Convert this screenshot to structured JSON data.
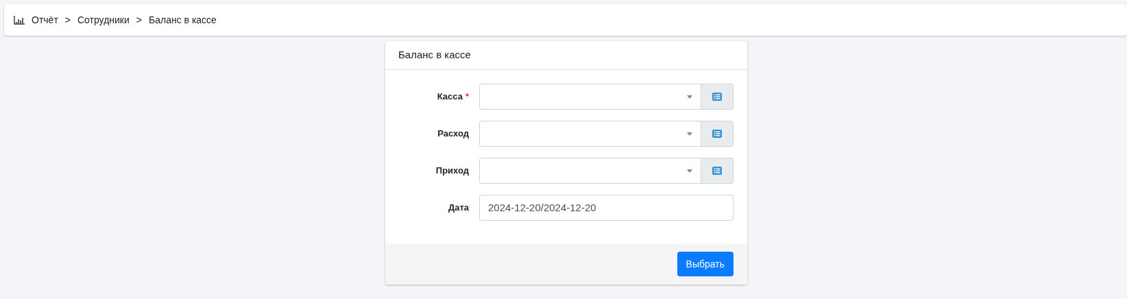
{
  "breadcrumb": [
    "Отчёт",
    "Сотрудники",
    "Баланс в кассе"
  ],
  "breadcrumb_separator": ">",
  "card": {
    "title": "Баланс в кассе",
    "fields": [
      {
        "kind": "select",
        "label": "Касса",
        "required": true
      },
      {
        "kind": "select",
        "label": "Расход",
        "required": false
      },
      {
        "kind": "select",
        "label": "Приход",
        "required": false
      },
      {
        "kind": "date",
        "label": "Дата",
        "required": false,
        "value": "2024-12-20/2024-12-20"
      }
    ],
    "required_mark": "*",
    "submit": "Выбрать"
  }
}
